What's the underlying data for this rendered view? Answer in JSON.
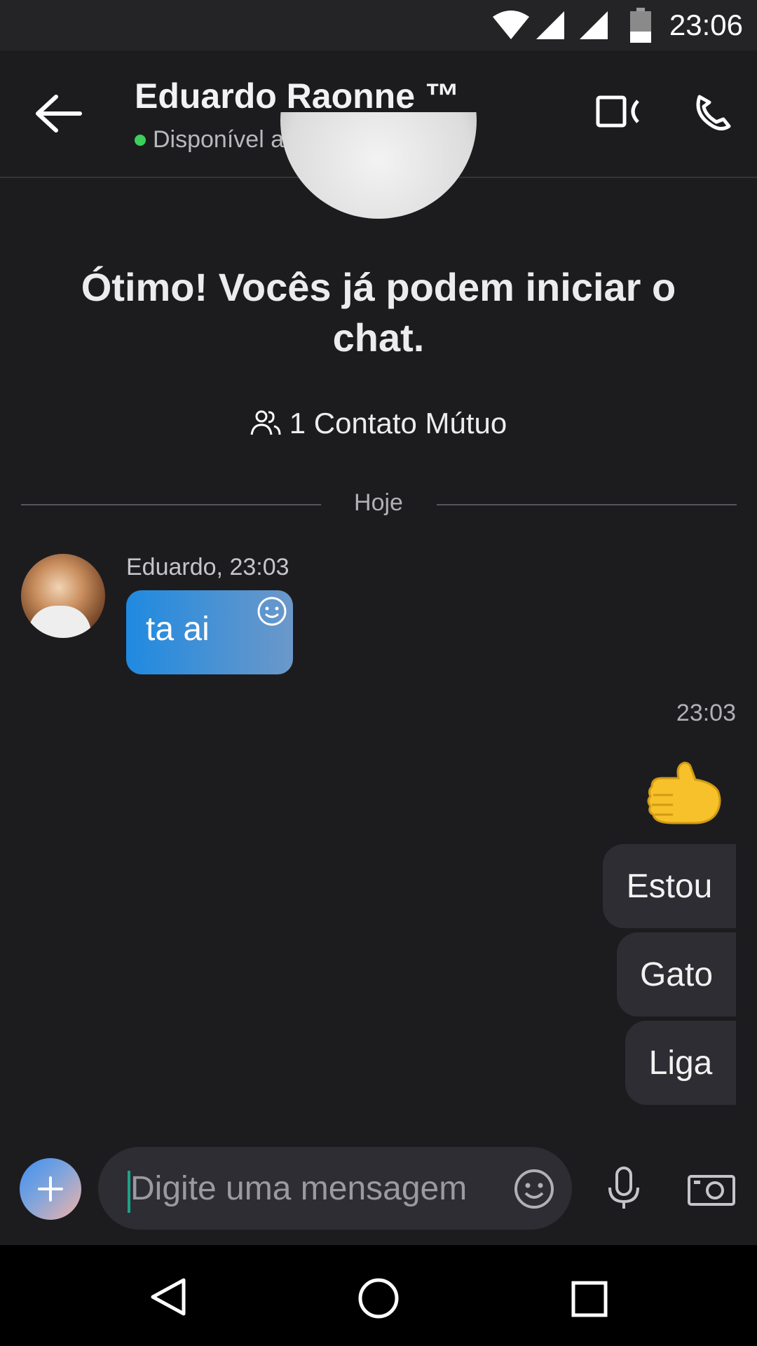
{
  "status_bar": {
    "time": "23:06",
    "icons": [
      "wifi-icon",
      "signal-icon",
      "signal-icon",
      "battery-icon"
    ]
  },
  "header": {
    "contact_name": "Eduardo Raonne ™",
    "presence": "Disponível agora",
    "presence_color": "#3ccf5a",
    "icons": [
      "arrow-left-icon",
      "video-camera-icon",
      "phone-icon"
    ]
  },
  "intro": {
    "message": "Ótimo! Vocês já podem iniciar o chat.",
    "mutual_contacts": "1 Contato Mútuo",
    "mutual_icon": "people-icon"
  },
  "divider": {
    "label": "Hoje"
  },
  "messages": {
    "incoming": {
      "sender_time": "Eduardo, 23:03",
      "text": "ta ai",
      "react_icon": "smiley-icon"
    },
    "outgoing": {
      "time": "23:03",
      "emoji": "thumbs-up-emoji",
      "bubbles": [
        "Estou",
        "Gato",
        "Liga"
      ]
    }
  },
  "composer": {
    "placeholder": "Digite uma mensagem",
    "value": "",
    "icons": [
      "plus-icon",
      "emoji-icon",
      "microphone-icon",
      "camera-icon"
    ]
  },
  "nav_bar": {
    "icons": [
      "back-triangle-icon",
      "home-circle-icon",
      "recents-square-icon"
    ]
  },
  "colors": {
    "background": "#1c1c1f",
    "bubble_blue": "#1f8ae0",
    "bubble_dark": "#2d2d33",
    "cursor": "#1ea28a"
  }
}
